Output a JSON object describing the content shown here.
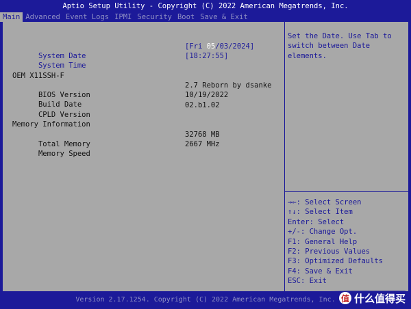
{
  "title": "Aptio Setup Utility - Copyright (C) 2022 American Megatrends, Inc.",
  "tabs": [
    "Main",
    "Advanced",
    "Event Logs",
    "IPMI",
    "Security",
    "Boot",
    "Save & Exit"
  ],
  "main": {
    "system_date": {
      "label": "System Date",
      "open": "[Fri ",
      "highlight": "05",
      "rest": "/03/2024]"
    },
    "system_time": {
      "label": "System Time",
      "value": "[18:27:55]"
    },
    "board": "OEM X11SSH-F",
    "bios_version": {
      "label": "BIOS Version",
      "value": "2.7 Reborn by dsanke"
    },
    "build_date": {
      "label": "Build Date",
      "value": "10/19/2022"
    },
    "cpld_version": {
      "label": "CPLD Version",
      "value": "02.b1.02"
    },
    "memory_header": "Memory Information",
    "total_memory": {
      "label": "Total Memory",
      "value": "32768 MB"
    },
    "memory_speed": {
      "label": "Memory Speed",
      "value": "2667 MHz"
    }
  },
  "help": {
    "line1": "Set the Date. Use Tab to",
    "line2": "switch between Date",
    "line3": "elements."
  },
  "keys": [
    "→←: Select Screen",
    "↑↓: Select Item",
    "Enter: Select",
    "+/-: Change Opt.",
    "F1: General Help",
    "F2: Previous Values",
    "F3: Optimized Defaults",
    "F4: Save & Exit",
    "ESC: Exit"
  ],
  "footer": "Version 2.17.1254. Copyright (C) 2022 American Megatrends, Inc.",
  "watermark": {
    "logo_glyph": "值",
    "text": "什么值得买"
  },
  "colors": {
    "background": "#1c1a99",
    "panel": "#a8a8a8",
    "highlight": "#ffffff"
  }
}
